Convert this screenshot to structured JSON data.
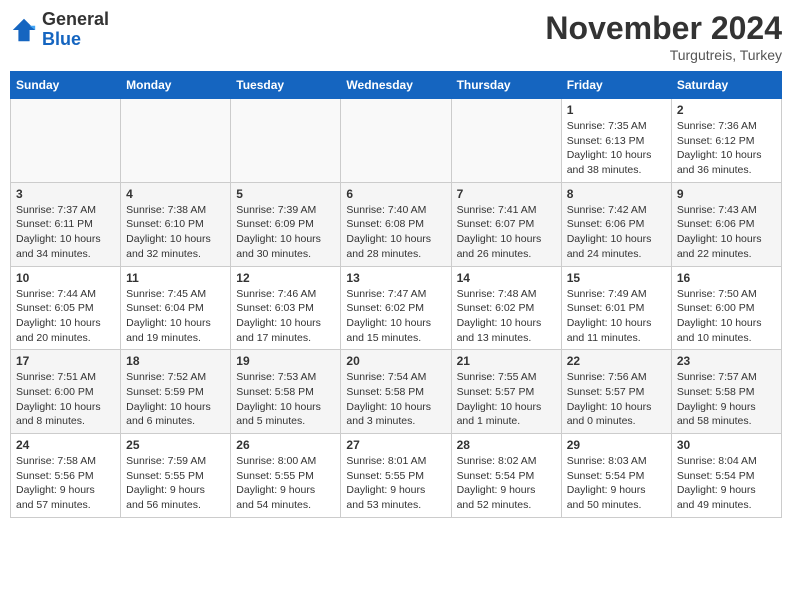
{
  "header": {
    "logo_general": "General",
    "logo_blue": "Blue",
    "month": "November 2024",
    "location": "Turgutreis, Turkey"
  },
  "days_of_week": [
    "Sunday",
    "Monday",
    "Tuesday",
    "Wednesday",
    "Thursday",
    "Friday",
    "Saturday"
  ],
  "weeks": [
    [
      {
        "day": "",
        "info": ""
      },
      {
        "day": "",
        "info": ""
      },
      {
        "day": "",
        "info": ""
      },
      {
        "day": "",
        "info": ""
      },
      {
        "day": "",
        "info": ""
      },
      {
        "day": "1",
        "info": "Sunrise: 7:35 AM\nSunset: 6:13 PM\nDaylight: 10 hours and 38 minutes."
      },
      {
        "day": "2",
        "info": "Sunrise: 7:36 AM\nSunset: 6:12 PM\nDaylight: 10 hours and 36 minutes."
      }
    ],
    [
      {
        "day": "3",
        "info": "Sunrise: 7:37 AM\nSunset: 6:11 PM\nDaylight: 10 hours and 34 minutes."
      },
      {
        "day": "4",
        "info": "Sunrise: 7:38 AM\nSunset: 6:10 PM\nDaylight: 10 hours and 32 minutes."
      },
      {
        "day": "5",
        "info": "Sunrise: 7:39 AM\nSunset: 6:09 PM\nDaylight: 10 hours and 30 minutes."
      },
      {
        "day": "6",
        "info": "Sunrise: 7:40 AM\nSunset: 6:08 PM\nDaylight: 10 hours and 28 minutes."
      },
      {
        "day": "7",
        "info": "Sunrise: 7:41 AM\nSunset: 6:07 PM\nDaylight: 10 hours and 26 minutes."
      },
      {
        "day": "8",
        "info": "Sunrise: 7:42 AM\nSunset: 6:06 PM\nDaylight: 10 hours and 24 minutes."
      },
      {
        "day": "9",
        "info": "Sunrise: 7:43 AM\nSunset: 6:06 PM\nDaylight: 10 hours and 22 minutes."
      }
    ],
    [
      {
        "day": "10",
        "info": "Sunrise: 7:44 AM\nSunset: 6:05 PM\nDaylight: 10 hours and 20 minutes."
      },
      {
        "day": "11",
        "info": "Sunrise: 7:45 AM\nSunset: 6:04 PM\nDaylight: 10 hours and 19 minutes."
      },
      {
        "day": "12",
        "info": "Sunrise: 7:46 AM\nSunset: 6:03 PM\nDaylight: 10 hours and 17 minutes."
      },
      {
        "day": "13",
        "info": "Sunrise: 7:47 AM\nSunset: 6:02 PM\nDaylight: 10 hours and 15 minutes."
      },
      {
        "day": "14",
        "info": "Sunrise: 7:48 AM\nSunset: 6:02 PM\nDaylight: 10 hours and 13 minutes."
      },
      {
        "day": "15",
        "info": "Sunrise: 7:49 AM\nSunset: 6:01 PM\nDaylight: 10 hours and 11 minutes."
      },
      {
        "day": "16",
        "info": "Sunrise: 7:50 AM\nSunset: 6:00 PM\nDaylight: 10 hours and 10 minutes."
      }
    ],
    [
      {
        "day": "17",
        "info": "Sunrise: 7:51 AM\nSunset: 6:00 PM\nDaylight: 10 hours and 8 minutes."
      },
      {
        "day": "18",
        "info": "Sunrise: 7:52 AM\nSunset: 5:59 PM\nDaylight: 10 hours and 6 minutes."
      },
      {
        "day": "19",
        "info": "Sunrise: 7:53 AM\nSunset: 5:58 PM\nDaylight: 10 hours and 5 minutes."
      },
      {
        "day": "20",
        "info": "Sunrise: 7:54 AM\nSunset: 5:58 PM\nDaylight: 10 hours and 3 minutes."
      },
      {
        "day": "21",
        "info": "Sunrise: 7:55 AM\nSunset: 5:57 PM\nDaylight: 10 hours and 1 minute."
      },
      {
        "day": "22",
        "info": "Sunrise: 7:56 AM\nSunset: 5:57 PM\nDaylight: 10 hours and 0 minutes."
      },
      {
        "day": "23",
        "info": "Sunrise: 7:57 AM\nSunset: 5:58 PM\nDaylight: 9 hours and 58 minutes."
      }
    ],
    [
      {
        "day": "24",
        "info": "Sunrise: 7:58 AM\nSunset: 5:56 PM\nDaylight: 9 hours and 57 minutes."
      },
      {
        "day": "25",
        "info": "Sunrise: 7:59 AM\nSunset: 5:55 PM\nDaylight: 9 hours and 56 minutes."
      },
      {
        "day": "26",
        "info": "Sunrise: 8:00 AM\nSunset: 5:55 PM\nDaylight: 9 hours and 54 minutes."
      },
      {
        "day": "27",
        "info": "Sunrise: 8:01 AM\nSunset: 5:55 PM\nDaylight: 9 hours and 53 minutes."
      },
      {
        "day": "28",
        "info": "Sunrise: 8:02 AM\nSunset: 5:54 PM\nDaylight: 9 hours and 52 minutes."
      },
      {
        "day": "29",
        "info": "Sunrise: 8:03 AM\nSunset: 5:54 PM\nDaylight: 9 hours and 50 minutes."
      },
      {
        "day": "30",
        "info": "Sunrise: 8:04 AM\nSunset: 5:54 PM\nDaylight: 9 hours and 49 minutes."
      }
    ]
  ]
}
